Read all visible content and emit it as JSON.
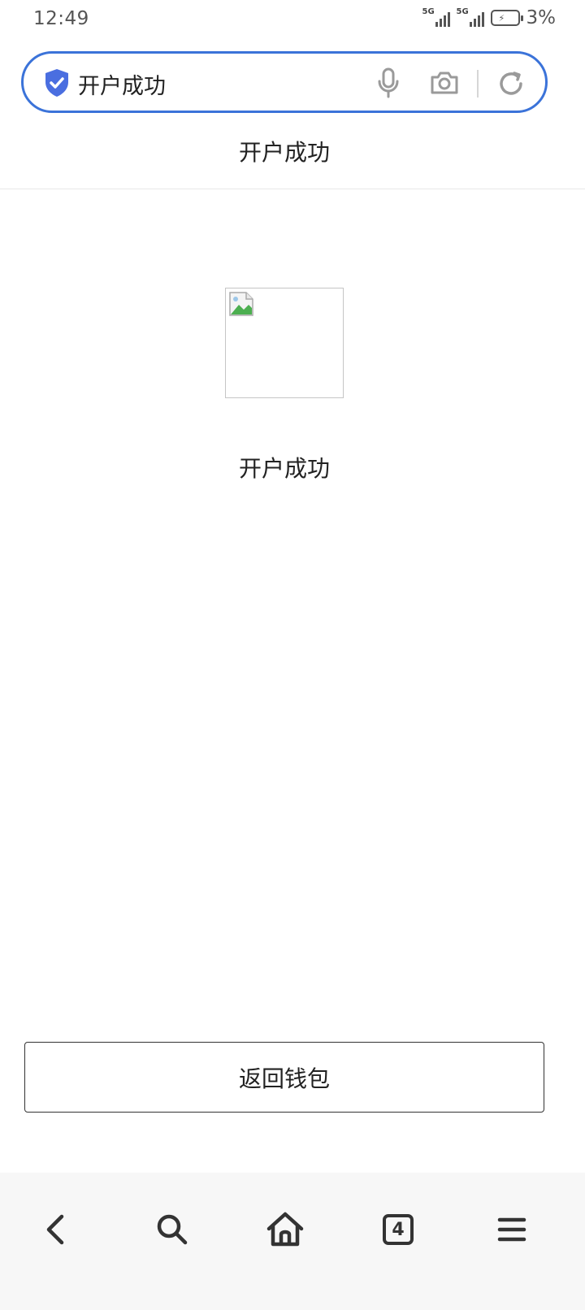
{
  "status_bar": {
    "time": "12:49",
    "sim1_network": "5G",
    "sim2_network": "5G",
    "battery_percent": "3%"
  },
  "address_bar": {
    "url_text": "开户成功",
    "icons": [
      "shield-check-icon",
      "mic-icon",
      "camera-icon",
      "reload-icon"
    ],
    "accent_color": "#3b73d9",
    "shield_color": "#4a6ee0"
  },
  "page": {
    "title": "开户成功",
    "success_message": "开户成功",
    "back_button_label": "返回钱包"
  },
  "bottom_nav": {
    "tab_count": "4",
    "icons": [
      "back-icon",
      "search-icon",
      "home-icon",
      "tabs-icon",
      "menu-icon"
    ]
  }
}
